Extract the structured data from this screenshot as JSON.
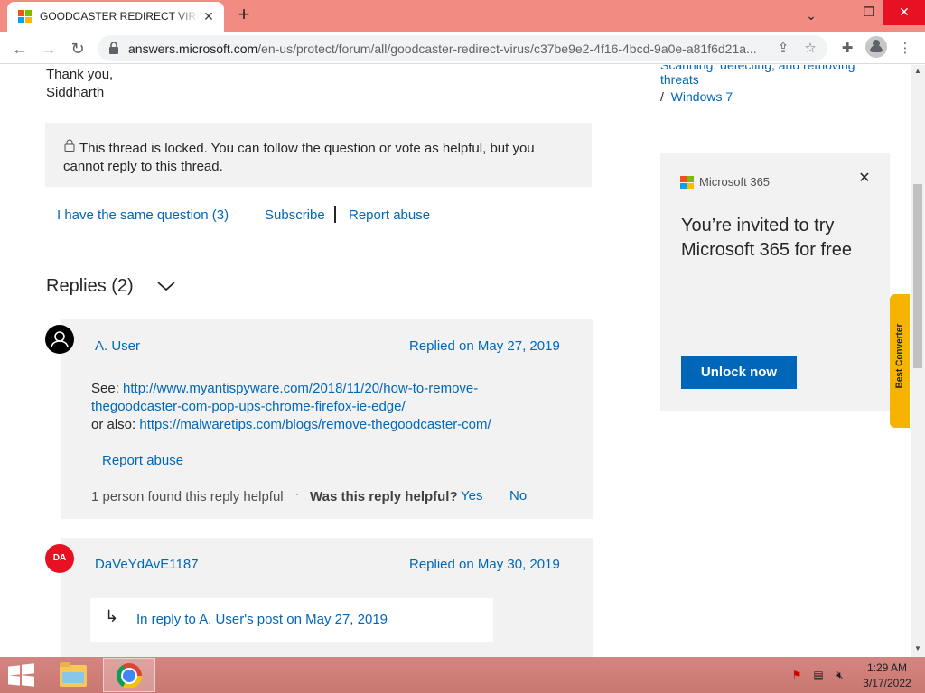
{
  "browser": {
    "tab_title": "GOODCASTER REDIRECT VIRUS - Microsoft Community",
    "url_host": "answers.microsoft.com",
    "url_path": "/en-us/protect/forum/all/goodcaster-redirect-virus/c37be9e2-4f16-4bcd-9a0e-a81f6d21a...",
    "new_tab": "+",
    "tab_close": "✕",
    "minimize": "⌄",
    "restore": "❐",
    "win_close": "✕"
  },
  "post": {
    "signoff_1": "Thank you,",
    "signoff_2": "Siddharth",
    "locked_message": "This thread is locked. You can follow the question or vote as helpful, but you cannot reply to this thread.",
    "same_question": "I have the same question (3)",
    "subscribe": "Subscribe",
    "report_abuse": "Report abuse"
  },
  "replies": {
    "title": "Replies (2)",
    "items": [
      {
        "user": "A. User",
        "date": "Replied on May 27, 2019",
        "see_label": "See: ",
        "link1_part1": "http://www.myantispyware.com/2018/11/20/how-to-remove-",
        "link1_part2": "thegoodcaster-com-pop-ups-chrome-firefox-ie-edge/",
        "or_label": "or also: ",
        "link2": "https://malwaretips.com/blogs/remove-thegoodcaster-com/",
        "report_abuse": "Report abuse",
        "helpful_count": "1 person found this reply helpful",
        "separator": "·",
        "helpful_question": "Was this reply helpful?",
        "yes": "Yes",
        "no": "No"
      },
      {
        "avatar_initials": "DA",
        "user": "DaVeYdAvE1187",
        "date": "Replied on May 30, 2019",
        "in_reply": "In reply to A. User's post on May 27, 2019",
        "arrow": "↳"
      }
    ]
  },
  "sidebar": {
    "breadcrumb_partial": "Scanning, detecting, and removing",
    "breadcrumb_threats": "threats",
    "breadcrumb_sep": "/",
    "breadcrumb_windows": "Windows 7",
    "ad": {
      "brand": "Microsoft 365",
      "headline": "You’re invited to try Microsoft 365 for free",
      "cta": "Unlock now",
      "close": "✕"
    },
    "widget_label": "Best Converter"
  },
  "taskbar": {
    "time": "1:29 AM",
    "date": "3/17/2022"
  },
  "colors": {
    "tabbar": "#f28b82",
    "link": "#0067b8",
    "ad_button": "#0067b8",
    "taskbar": "#c97771"
  }
}
